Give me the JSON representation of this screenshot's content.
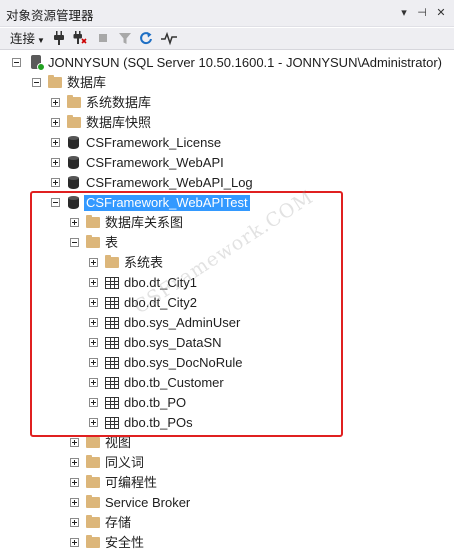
{
  "window": {
    "title": "对象资源管理器"
  },
  "title_buttons": [
    "▾",
    "⊣",
    "✕"
  ],
  "toolbar": {
    "connect_label": "连接",
    "icons": [
      "connect-plug-icon",
      "disconnect-icon",
      "stop-icon",
      "filter-icon",
      "refresh-icon",
      "activity-monitor-icon"
    ]
  },
  "tree": {
    "server": "JONNYSUN (SQL Server 10.50.1600.1 - JONNYSUN\\Administrator)",
    "databases_folder": "数据库",
    "system_databases": "系统数据库",
    "snapshots": "数据库快照",
    "db_license": "CSFramework_License",
    "db_webapi": "CSFramework_WebAPI",
    "db_webapi_log": "CSFramework_WebAPI_Log",
    "db_webapitest": "CSFramework_WebAPITest",
    "diagrams": "数据库关系图",
    "tables": "表",
    "system_tables": "系统表",
    "table_items": [
      "dbo.dt_City1",
      "dbo.dt_City2",
      "dbo.sys_AdminUser",
      "dbo.sys_DataSN",
      "dbo.sys_DocNoRule",
      "dbo.tb_Customer",
      "dbo.tb_PO",
      "dbo.tb_POs"
    ],
    "views": "视图",
    "synonyms": "同义词",
    "programmability": "可编程性",
    "service_broker": "Service Broker",
    "storage": "存储",
    "security": "安全性"
  },
  "watermark": "CSFramework.COM",
  "colors": {
    "selection": "#3399ff",
    "highlight_border": "#e02020",
    "folder": "#dcb67a"
  }
}
